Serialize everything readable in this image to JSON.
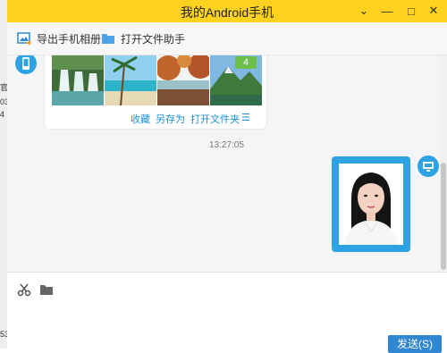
{
  "window": {
    "title": "我的Android手机"
  },
  "title_controls": {
    "collapse": "⌄",
    "minimize": "—",
    "maximize": "□",
    "close": "✕"
  },
  "toolbar": {
    "export_album": "导出手机相册",
    "open_file_assistant": "打开文件助手"
  },
  "background_fragments": [
    "官",
    "03",
    "4",
    "53"
  ],
  "chat": {
    "image_count_badge": "4",
    "actions": {
      "favorite": "收藏",
      "save_as": "另存为",
      "open_folder": "打开文件夹",
      "menu": "☰"
    },
    "timestamp": "13:27:05"
  },
  "input": {
    "send_label": "发送(S)"
  },
  "colors": {
    "title_bar": "#ffd21f",
    "accent": "#2ea3e3",
    "send": "#2f86d1",
    "badge": "#6cc04a"
  }
}
